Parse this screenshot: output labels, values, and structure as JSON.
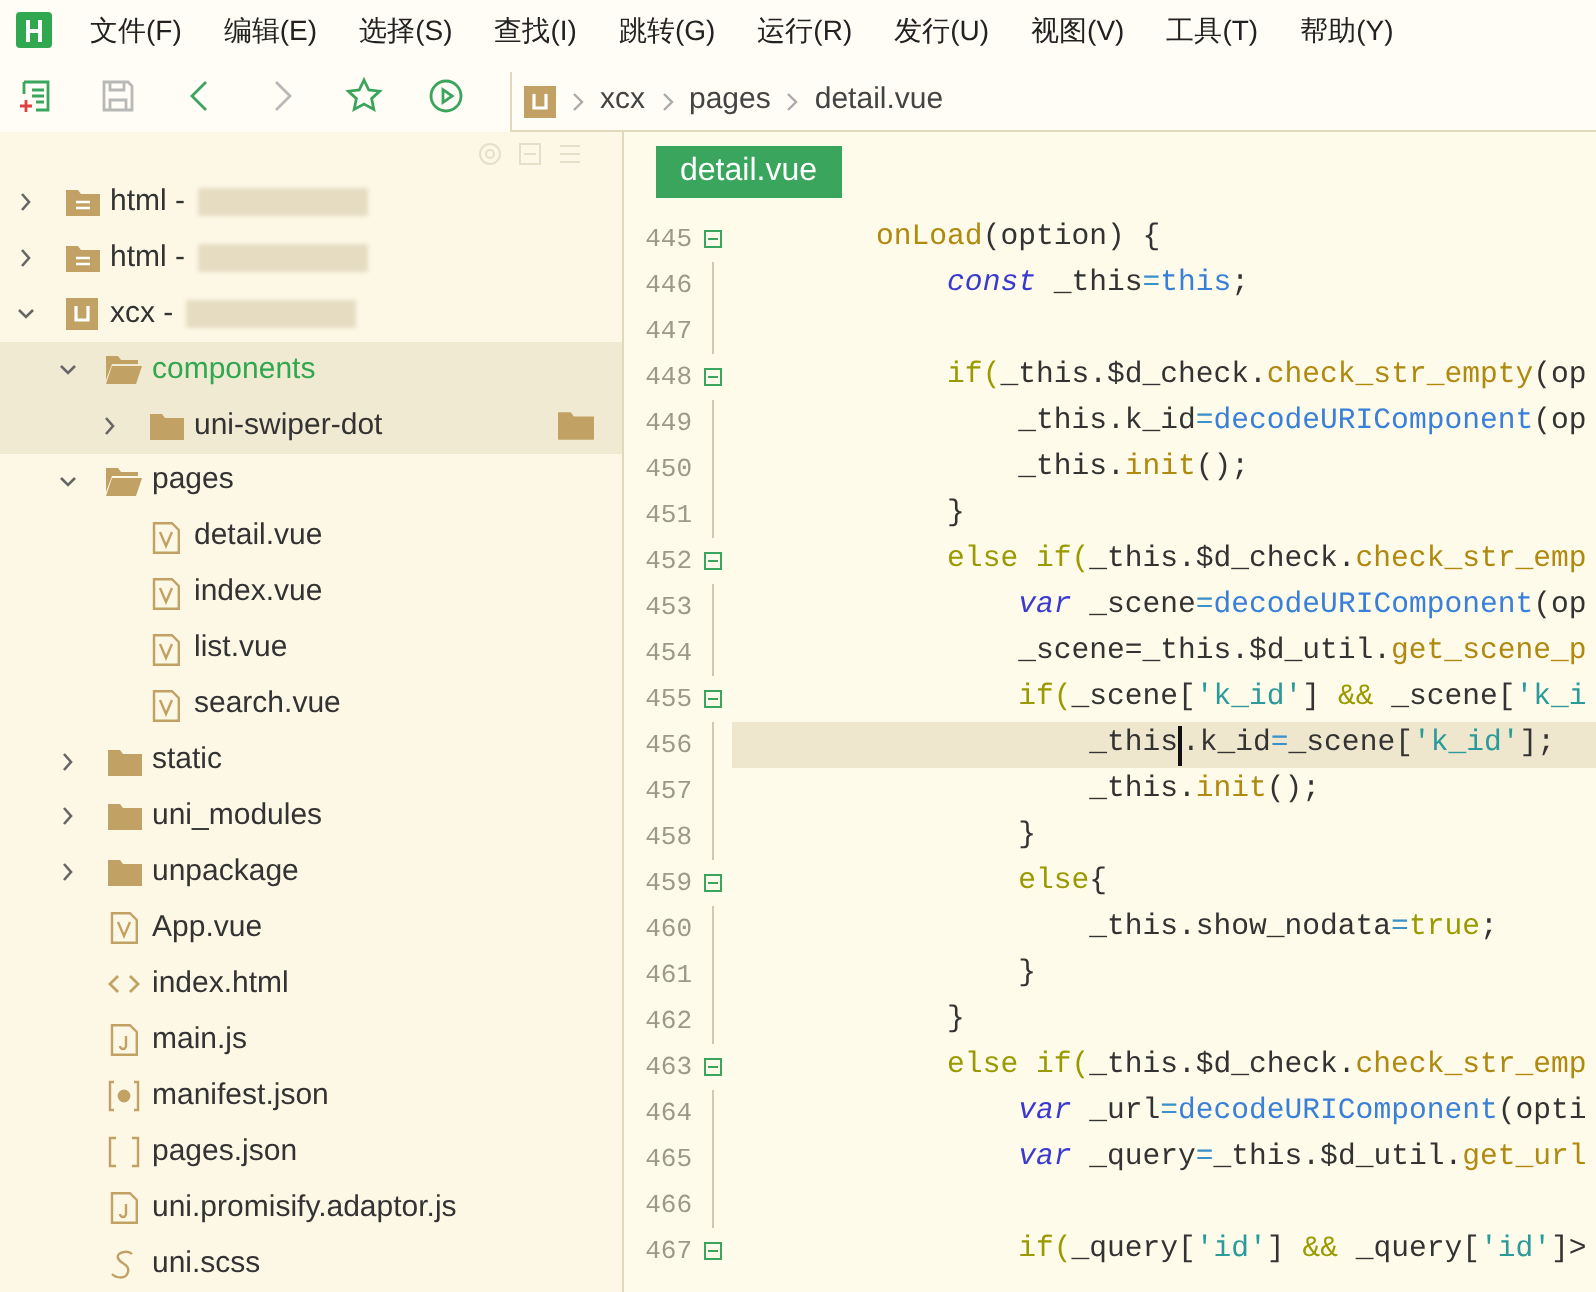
{
  "menu": [
    {
      "label": "文件(F)"
    },
    {
      "label": "编辑(E)"
    },
    {
      "label": "选择(S)"
    },
    {
      "label": "查找(I)"
    },
    {
      "label": "跳转(G)"
    },
    {
      "label": "运行(R)"
    },
    {
      "label": "发行(U)"
    },
    {
      "label": "视图(V)"
    },
    {
      "label": "工具(T)"
    },
    {
      "label": "帮助(Y)"
    }
  ],
  "toolbar": {
    "buttons": [
      {
        "kind": "new-file",
        "disabled": false
      },
      {
        "kind": "save",
        "disabled": true
      },
      {
        "kind": "back",
        "disabled": false
      },
      {
        "kind": "forward",
        "disabled": true
      },
      {
        "kind": "star",
        "disabled": false
      },
      {
        "kind": "run",
        "disabled": false
      }
    ]
  },
  "breadcrumb": [
    {
      "label": "xcx"
    },
    {
      "label": "pages"
    },
    {
      "label": "detail.vue"
    }
  ],
  "sidebar": {
    "items": [
      {
        "name": "html -",
        "kind": "web-project",
        "expanded": false,
        "selected": false,
        "redacted": true
      },
      {
        "name": "html -",
        "kind": "web-project",
        "expanded": false,
        "selected": false,
        "redacted": true
      },
      {
        "name": "xcx -",
        "kind": "uni-project",
        "expanded": true,
        "selected": false,
        "redacted": true,
        "children": [
          {
            "name": "components",
            "kind": "folder",
            "expanded": true,
            "selected": true,
            "children": [
              {
                "name": "uni-swiper-dot",
                "kind": "folder",
                "expanded": false,
                "selected": false,
                "hovered": true
              }
            ]
          },
          {
            "name": "pages",
            "kind": "folder",
            "expanded": true,
            "selected": false,
            "children": [
              {
                "name": "detail.vue",
                "kind": "vue",
                "selected": false
              },
              {
                "name": "index.vue",
                "kind": "vue",
                "selected": false
              },
              {
                "name": "list.vue",
                "kind": "vue",
                "selected": false
              },
              {
                "name": "search.vue",
                "kind": "vue",
                "selected": false
              }
            ]
          },
          {
            "name": "static",
            "kind": "folder",
            "expanded": false,
            "selected": false
          },
          {
            "name": "uni_modules",
            "kind": "folder",
            "expanded": false,
            "selected": false
          },
          {
            "name": "unpackage",
            "kind": "folder",
            "expanded": false,
            "selected": false
          },
          {
            "name": "App.vue",
            "kind": "vue",
            "selected": false
          },
          {
            "name": "index.html",
            "kind": "html",
            "selected": false
          },
          {
            "name": "main.js",
            "kind": "js",
            "selected": false
          },
          {
            "name": "manifest.json",
            "kind": "manifest",
            "selected": false
          },
          {
            "name": "pages.json",
            "kind": "json",
            "selected": false
          },
          {
            "name": "uni.promisify.adaptor.js",
            "kind": "js",
            "selected": false
          },
          {
            "name": "uni.scss",
            "kind": "scss",
            "selected": false
          }
        ]
      }
    ]
  },
  "editor": {
    "tab": {
      "label": "detail.vue",
      "selected": true
    },
    "lines": [
      {
        "number": "445",
        "fold": true,
        "current": false,
        "tokens": [
          {
            "text": "        onLoad",
            "kind": "method"
          },
          {
            "text": "(option) {",
            "kind": "plain"
          }
        ]
      },
      {
        "number": "446",
        "fold": false,
        "current": false,
        "tokens": [
          {
            "text": "            const",
            "kind": "storage"
          },
          {
            "text": " _this",
            "kind": "plain"
          },
          {
            "text": "=",
            "kind": "op"
          },
          {
            "text": "this",
            "kind": "builtin"
          },
          {
            "text": ";",
            "kind": "plain"
          }
        ]
      },
      {
        "number": "447",
        "fold": false,
        "current": false
      },
      {
        "number": "448",
        "fold": true,
        "current": false,
        "tokens": [
          {
            "text": "            if(",
            "kind": "keyword"
          },
          {
            "text": "_this.$d_check.",
            "kind": "plain"
          },
          {
            "text": "check_str_empty",
            "kind": "method"
          },
          {
            "text": "(op",
            "kind": "plain"
          }
        ]
      },
      {
        "number": "449",
        "fold": false,
        "current": false,
        "tokens": [
          {
            "text": "                _this.k_id",
            "kind": "plain"
          },
          {
            "text": "=",
            "kind": "op"
          },
          {
            "text": "decodeURIComponent",
            "kind": "builtin"
          },
          {
            "text": "(op",
            "kind": "plain"
          }
        ]
      },
      {
        "number": "450",
        "fold": false,
        "current": false,
        "tokens": [
          {
            "text": "                _this.",
            "kind": "plain"
          },
          {
            "text": "init",
            "kind": "method"
          },
          {
            "text": "();",
            "kind": "plain"
          }
        ]
      },
      {
        "number": "451",
        "fold": false,
        "current": false,
        "tokens": [
          {
            "text": "            }",
            "kind": "plain"
          }
        ]
      },
      {
        "number": "452",
        "fold": true,
        "current": false,
        "tokens": [
          {
            "text": "            else if(",
            "kind": "keyword"
          },
          {
            "text": "_this.$d_check.",
            "kind": "plain"
          },
          {
            "text": "check_str_emp",
            "kind": "method"
          }
        ]
      },
      {
        "number": "453",
        "fold": false,
        "current": false,
        "tokens": [
          {
            "text": "                var",
            "kind": "storage"
          },
          {
            "text": " _scene",
            "kind": "plain"
          },
          {
            "text": "=",
            "kind": "op"
          },
          {
            "text": "decodeURIComponent",
            "kind": "builtin"
          },
          {
            "text": "(op",
            "kind": "plain"
          }
        ]
      },
      {
        "number": "454",
        "fold": false,
        "current": false,
        "tokens": [
          {
            "text": "                _scene=_this.$d_util.",
            "kind": "plain"
          },
          {
            "text": "get_scene_p",
            "kind": "method"
          }
        ]
      },
      {
        "number": "455",
        "fold": true,
        "current": false,
        "tokens": [
          {
            "text": "                if(",
            "kind": "keyword"
          },
          {
            "text": "_scene[",
            "kind": "plain"
          },
          {
            "text": "'k_id'",
            "kind": "string"
          },
          {
            "text": "] ",
            "kind": "plain"
          },
          {
            "text": "&&",
            "kind": "keyword"
          },
          {
            "text": " _scene[",
            "kind": "plain"
          },
          {
            "text": "'k_i",
            "kind": "string"
          }
        ]
      },
      {
        "number": "456",
        "fold": false,
        "current": true,
        "tokens": [
          {
            "text": "                    _this",
            "kind": "plain",
            "cursor_after": true
          },
          {
            "text": ".k_id",
            "kind": "plain"
          },
          {
            "text": "=",
            "kind": "op"
          },
          {
            "text": "_scene[",
            "kind": "plain"
          },
          {
            "text": "'k_id'",
            "kind": "string"
          },
          {
            "text": "];",
            "kind": "plain"
          }
        ]
      },
      {
        "number": "457",
        "fold": false,
        "current": false,
        "tokens": [
          {
            "text": "                    _this.",
            "kind": "plain"
          },
          {
            "text": "init",
            "kind": "method"
          },
          {
            "text": "();",
            "kind": "plain"
          }
        ]
      },
      {
        "number": "458",
        "fold": false,
        "current": false,
        "tokens": [
          {
            "text": "                }",
            "kind": "plain"
          }
        ]
      },
      {
        "number": "459",
        "fold": true,
        "current": false,
        "tokens": [
          {
            "text": "                else",
            "kind": "keyword"
          },
          {
            "text": "{",
            "kind": "plain"
          }
        ]
      },
      {
        "number": "460",
        "fold": false,
        "current": false,
        "tokens": [
          {
            "text": "                    _this.show_nodata",
            "kind": "plain"
          },
          {
            "text": "=",
            "kind": "op"
          },
          {
            "text": "true",
            "kind": "keyword"
          },
          {
            "text": ";",
            "kind": "plain"
          }
        ]
      },
      {
        "number": "461",
        "fold": false,
        "current": false,
        "tokens": [
          {
            "text": "                }",
            "kind": "plain"
          }
        ]
      },
      {
        "number": "462",
        "fold": false,
        "current": false,
        "tokens": [
          {
            "text": "            }",
            "kind": "plain"
          }
        ]
      },
      {
        "number": "463",
        "fold": true,
        "current": false,
        "tokens": [
          {
            "text": "            else if(",
            "kind": "keyword"
          },
          {
            "text": "_this.$d_check.",
            "kind": "plain"
          },
          {
            "text": "check_str_emp",
            "kind": "method"
          }
        ]
      },
      {
        "number": "464",
        "fold": false,
        "current": false,
        "tokens": [
          {
            "text": "                var",
            "kind": "storage"
          },
          {
            "text": " _url",
            "kind": "plain"
          },
          {
            "text": "=",
            "kind": "op"
          },
          {
            "text": "decodeURIComponent",
            "kind": "builtin"
          },
          {
            "text": "(opti",
            "kind": "plain"
          }
        ]
      },
      {
        "number": "465",
        "fold": false,
        "current": false,
        "tokens": [
          {
            "text": "                var",
            "kind": "storage"
          },
          {
            "text": " _query",
            "kind": "plain"
          },
          {
            "text": "=",
            "kind": "op"
          },
          {
            "text": "_this.$d_util.",
            "kind": "plain"
          },
          {
            "text": "get_url",
            "kind": "method"
          }
        ]
      },
      {
        "number": "466",
        "fold": false,
        "current": false
      },
      {
        "number": "467",
        "fold": true,
        "current": false,
        "tokens": [
          {
            "text": "                if(",
            "kind": "keyword"
          },
          {
            "text": "_query[",
            "kind": "plain"
          },
          {
            "text": "'id'",
            "kind": "string"
          },
          {
            "text": "] ",
            "kind": "plain"
          },
          {
            "text": "&&",
            "kind": "keyword"
          },
          {
            "text": " _query[",
            "kind": "plain"
          },
          {
            "text": "'id'",
            "kind": "string"
          },
          {
            "text": "]>",
            "kind": "plain"
          }
        ]
      }
    ]
  }
}
